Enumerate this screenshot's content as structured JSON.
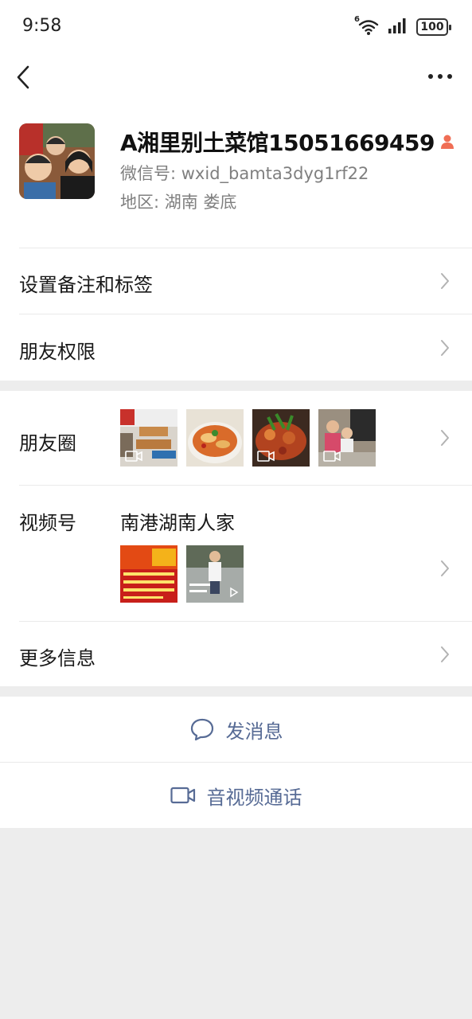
{
  "status_bar": {
    "time": "9:58",
    "network": "6",
    "battery": "100"
  },
  "nav": {
    "back_icon": "chevron-left-icon",
    "more_icon": "ellipsis-icon"
  },
  "profile": {
    "name": "A湘里别土菜馆15051669459",
    "wechat_id": "微信号: wxid_bamta3dyg1rf22",
    "region": "地区: 湖南  娄底",
    "gender_icon": "user-gender-icon",
    "gender_color": "#f06e55"
  },
  "menu": {
    "remark_tags": "设置备注和标签",
    "friend_permissions": "朋友权限",
    "moments": "朋友圈",
    "channels": "视频号",
    "channels_name": "南港湖南人家",
    "more_info": "更多信息"
  },
  "actions": {
    "send_message": "发消息",
    "av_call": "音视频通话",
    "accent_color": "#576b95"
  }
}
